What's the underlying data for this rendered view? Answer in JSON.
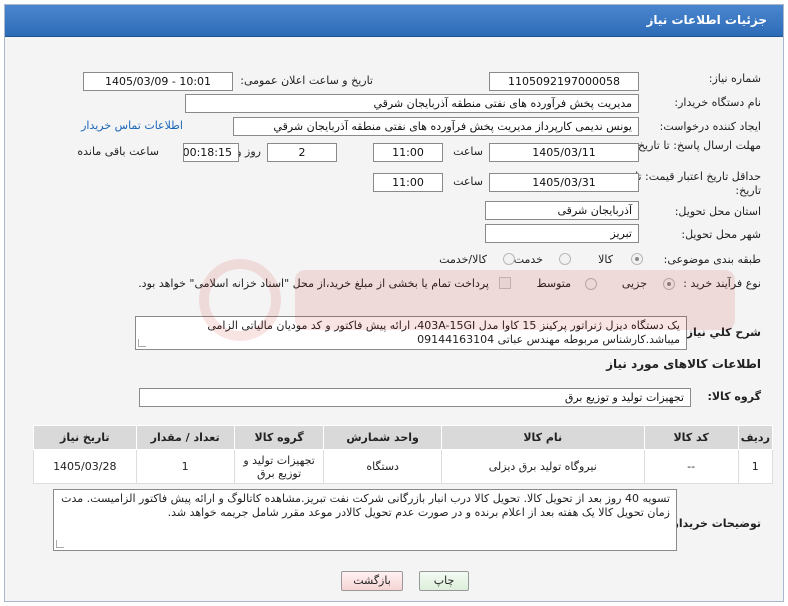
{
  "window": {
    "title": "جزئیات اطلاعات نیاز"
  },
  "form": {
    "need_number_label": "شماره نیاز:",
    "need_number": "1105092197000058",
    "announce_label": "تاریخ و ساعت اعلان عمومی:",
    "announce_value": "1405/03/09 - 10:01",
    "buyer_org_label": "نام دستگاه خریدار:",
    "buyer_org": "مدیریت پخش فرآورده های نفتی منطقه آذربایجان شرقي",
    "creator_label": "ایجاد کننده درخواست:",
    "creator": "یونس ندیمی کارپرداز مدیریت پخش فرآورده های نفتی منطقه آذربایجان شرقي",
    "contact_link": "اطلاعات تماس خریدار",
    "deadline_label": "مهلت ارسال پاسخ: تا تاریخ:",
    "deadline_date": "1405/03/11",
    "time_label": "ساعت",
    "deadline_time": "11:00",
    "days_value": "2",
    "days_label": "روز و",
    "remaining_time": "00:18:15",
    "remaining_label": "ساعت باقی مانده",
    "validity_label": "حداقل تاریخ اعتبار قیمت: تا تاریخ:",
    "validity_date": "1405/03/31",
    "validity_time": "11:00",
    "province_label": "استان محل تحویل:",
    "province": "آذربایجان شرقی",
    "city_label": "شهر محل تحویل:",
    "city": "تبریز",
    "category_label": "طبقه بندی موضوعی:",
    "category_options": [
      "کالا",
      "خدمت",
      "کالا/خدمت"
    ],
    "process_label": "نوع فرآیند خرید :",
    "process_options": [
      "جزیی",
      "متوسط"
    ],
    "payment_note": "پرداخت تمام یا بخشی از مبلغ خرید،از محل \"اسناد خزانه اسلامی\" خواهد بود."
  },
  "description": {
    "label": "شرح کلي نياز:",
    "text": "یک دستگاه دیزل ژنراتور پرکینز 15 کاوا مدل 403A-15GI، ارائه پیش فاکتور و کد مودیان مالیاتی الزامی میباشد.کارشناس مربوطه مهندس عباتی 09144163104"
  },
  "goods": {
    "section_title": "اطلاعات کالاهای مورد نیاز",
    "group_label": "گروه کالا:",
    "group_value": "تجهیزات تولید و توزیع برق",
    "columns": [
      "ردیف",
      "کد کالا",
      "نام کالا",
      "واحد شمارش",
      "گروه کالا",
      "تعداد / مقدار",
      "تاریخ نیاز"
    ],
    "rows": [
      {
        "row": "1",
        "code": "--",
        "name": "نیروگاه تولید برق دیزلی",
        "unit": "دستگاه",
        "group": "تجهیزات تولید و توزیع برق",
        "qty": "1",
        "date": "1405/03/28"
      }
    ]
  },
  "buyer_notes": {
    "label": "توضیحات خریدار:",
    "text": "تسویه 40 روز بعد از تحویل کالا. تحویل کالا درب انبار بازرگانی شرکت نفت تبریز.مشاهده کاتالوگ و ارائه پیش فاکتور الزامیست. مدت زمان تحویل کالا یک هفته بعد از اعلام برنده و در صورت عدم تحویل کالادر موعد مقرر شامل جریمه خواهد شد."
  },
  "buttons": {
    "print": "چاپ",
    "back": "بازگشت"
  },
  "colors": {
    "titlebar": "#3a7bc8",
    "link": "#1a66b8"
  }
}
